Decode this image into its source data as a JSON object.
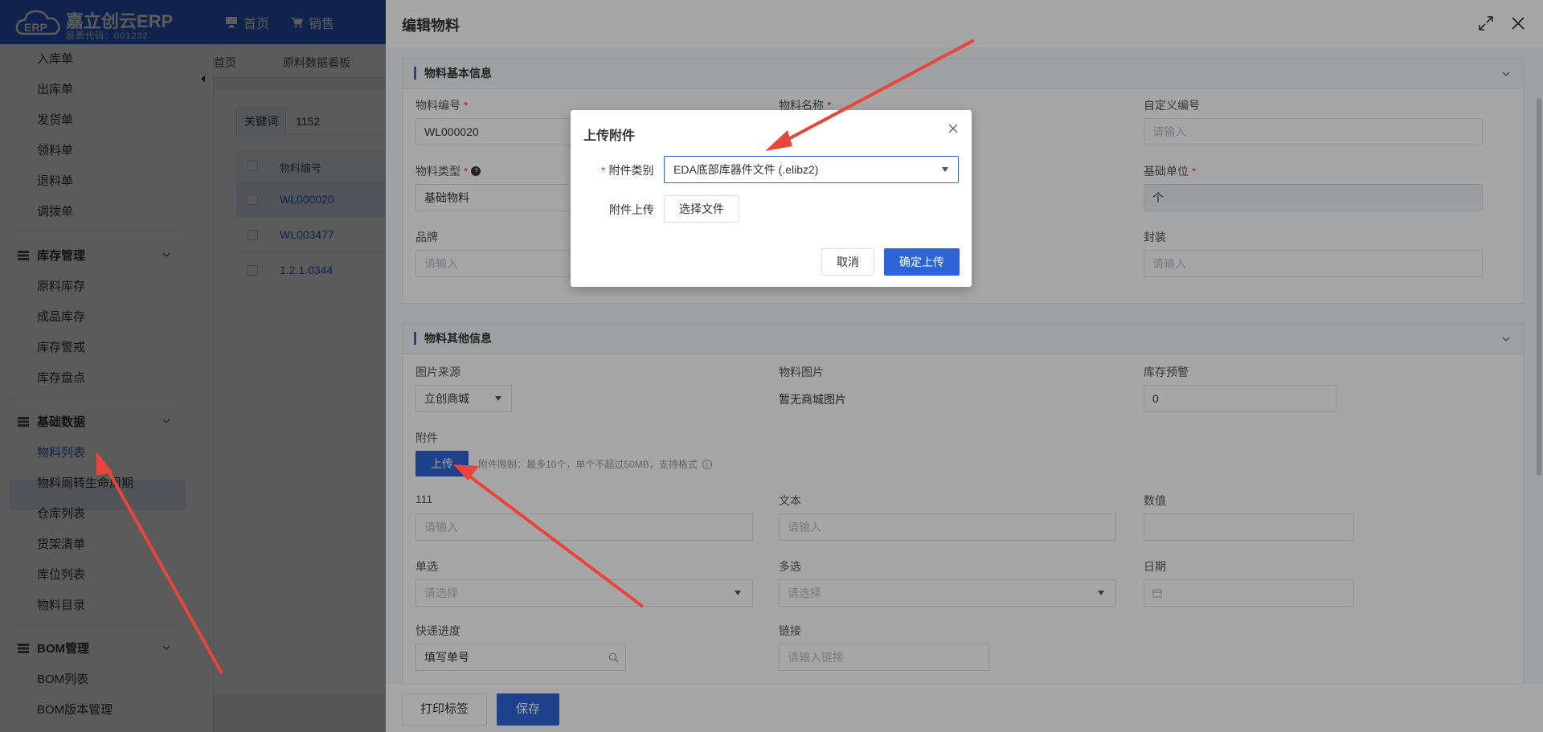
{
  "header": {
    "brand": "嘉立创云ERP",
    "stock_code": "股票代码：001232",
    "nav": [
      {
        "label": "首页",
        "icon": "monitor-icon"
      },
      {
        "label": "销售",
        "icon": "cart-icon"
      }
    ]
  },
  "sidebar": {
    "items_top": [
      "入库单",
      "出库单",
      "发货单",
      "领料单",
      "退料单",
      "调拨单"
    ],
    "groups": [
      {
        "label": "库存管理",
        "items": [
          "原料库存",
          "成品库存",
          "库存警戒",
          "库存盘点"
        ]
      },
      {
        "label": "基础数据",
        "items": [
          "物料列表",
          "物料周转生命周期",
          "仓库列表",
          "货架清单",
          "库位列表",
          "物料目录"
        ]
      },
      {
        "label": "BOM管理",
        "items": [
          "BOM列表",
          "BOM版本管理"
        ]
      }
    ],
    "active": "物料列表"
  },
  "tabs": [
    "首页",
    "原料数据看板"
  ],
  "filter": {
    "label": "关键词",
    "value": "1152"
  },
  "table": {
    "column": "物料编号",
    "rows": [
      "WL000020",
      "WL003477",
      "1.2.1.0344"
    ]
  },
  "drawer": {
    "title": "编辑物料",
    "section_basic": {
      "title": "物料基本信息",
      "fields": {
        "code_label": "物料编号",
        "code_value": "WL000020",
        "name_label": "物料名称",
        "custom_code_label": "自定义编号",
        "custom_code_placeholder": "请输入",
        "type_label": "物料类型",
        "type_value": "基础物料",
        "unit_label": "基础单位",
        "unit_value": "个",
        "brand_label": "品牌",
        "brand_placeholder": "请输入",
        "package_label": "封装",
        "package_placeholder": "请输入"
      }
    },
    "section_other": {
      "title": "物料其他信息",
      "fields": {
        "img_source_label": "图片来源",
        "img_source_value": "立创商城",
        "img_label": "物料图片",
        "img_value": "暂无商城图片",
        "stock_warn_label": "库存预警",
        "stock_warn_value": "0",
        "attach_label": "附件",
        "upload_label": "上传",
        "upload_hint": "附件限制：最多10个，单个不超过50MB，支持格式",
        "f111_label": "111",
        "f111_placeholder": "请输入",
        "text_label": "文本",
        "text_placeholder": "请输入",
        "number_label": "数值",
        "single_label": "单选",
        "single_placeholder": "请选择",
        "multi_label": "多选",
        "multi_placeholder": "请选择",
        "date_label": "日期",
        "express_label": "快递进度",
        "express_placeholder": "填写单号",
        "link_label": "链接",
        "link_placeholder": "请输入链接"
      }
    },
    "footer": {
      "print_label": "打印标签",
      "save_label": "保存"
    }
  },
  "modal": {
    "title": "上传附件",
    "category_label": "附件类别",
    "category_value": "EDA底部库器件文件 (.elibz2)",
    "upload_label": "附件上传",
    "choose_file_label": "选择文件",
    "cancel_label": "取消",
    "confirm_label": "确定上传"
  },
  "colors": {
    "primary": "#2f64d6",
    "arrow": "#e8453c"
  }
}
